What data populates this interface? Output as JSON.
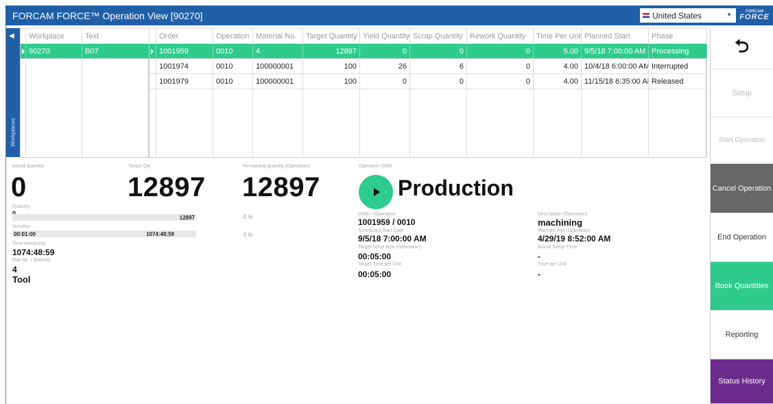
{
  "app": {
    "title": "FORCAM FORCE™ Operation View [90270]",
    "country": "United States",
    "logo_small": "FORCAM",
    "logo_big": "FORCE"
  },
  "workplaces": {
    "tab_label": "Workplaces",
    "columns": [
      "Workplace",
      "Text"
    ],
    "rows": [
      {
        "workplace": "90270",
        "text": "B07"
      }
    ]
  },
  "operations": {
    "columns": [
      "Order",
      "Operation",
      "Material No.",
      "Target Quantity",
      "Yield Quantity",
      "Scrap Quantity",
      "Rework Quantity",
      "Time Per Unit",
      "Planned Start",
      "Phase"
    ],
    "rows": [
      {
        "order": "1001959",
        "operation": "0010",
        "material": "4",
        "target": "12897",
        "yield": "0",
        "scrap": "0",
        "rework": "0",
        "time_per_unit": "5.00",
        "planned_start": "9/5/18 7:00:00 AM",
        "phase": "Processing"
      },
      {
        "order": "1001974",
        "operation": "0010",
        "material": "100000001",
        "target": "100",
        "yield": "26",
        "scrap": "6",
        "rework": "0",
        "time_per_unit": "4.00",
        "planned_start": "10/4/18 6:00:00 AM",
        "phase": "Interrupted"
      },
      {
        "order": "1001979",
        "operation": "0010",
        "material": "100000001",
        "target": "100",
        "yield": "0",
        "scrap": "0",
        "rework": "0",
        "time_per_unit": "4.00",
        "planned_start": "11/15/18 6:35:00 AM",
        "phase": "Released"
      }
    ]
  },
  "info": {
    "actual_quantity_label": "Actual quantity",
    "actual_quantity": "0",
    "target_qty_label": "Target Qty",
    "target_qty": "12897",
    "remaining_label": "Remaining quantity (Operation)",
    "remaining": "12897",
    "state_label": "Operation State",
    "state": "Production",
    "quantity_label": "Quantity",
    "quantity_value": "0",
    "quantity_bar_total": "12897",
    "quantity_pct": "0 %",
    "duration_label": "Duration",
    "duration_value": "00:01:00",
    "duration_bar_total": "1074:48:59",
    "duration_pct": "0 %",
    "time_remaining_label": "Time remaining",
    "time_remaining": "1074:48:59",
    "material_label": "Mat.No. / Material",
    "material_no": "4",
    "material_name": "Tool",
    "order_op_label": "Order / Operation",
    "order_op": "1001959 / 0010",
    "sched_start_label": "Scheduled Start Date",
    "sched_start": "9/5/18 7:00:00 AM",
    "setup_time_label": "Target setup time (Operation)",
    "setup_time": "00:05:00",
    "target_time_unit_label": "Target Time per Unit",
    "target_time_unit": "00:05:00",
    "desc_label": "Description (Operation)",
    "desc": "machining",
    "planned_end_label": "Planned end (Operation)",
    "planned_end": "4/29/19 8:52:00 AM",
    "actual_setup_label": "Actual Setup Time",
    "actual_setup": "-",
    "time_per_unit_label": "Time per Unit",
    "time_per_unit": "-"
  },
  "actions": {
    "back": "⮌",
    "setup": "Setup",
    "start": "Start Operation",
    "cancel": "Cancel Operation",
    "end": "End Operation",
    "book": "Book Quantities",
    "reporting": "Reporting",
    "history": "Status History"
  },
  "colors": {
    "titlebar": "#1f5fa8",
    "selected_row": "#2ecb8e",
    "cancel": "#666666",
    "history": "#6b2b8c"
  }
}
